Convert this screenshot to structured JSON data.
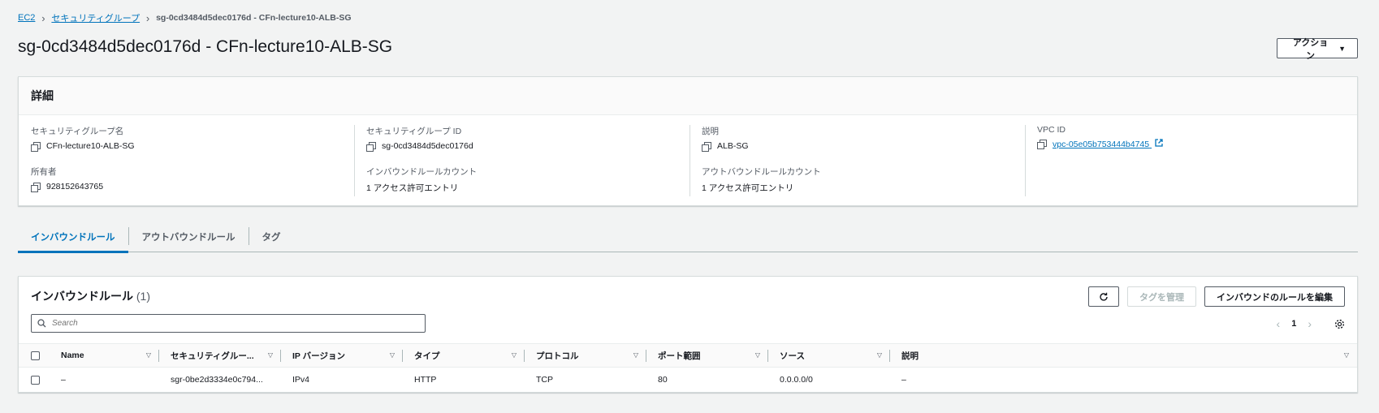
{
  "breadcrumb": {
    "items": [
      "EC2",
      "セキュリティグループ"
    ],
    "current": "sg-0cd3484d5dec0176d - CFn-lecture10-ALB-SG"
  },
  "page": {
    "title": "sg-0cd3484d5dec0176d - CFn-lecture10-ALB-SG",
    "actions_label": "アクション"
  },
  "details": {
    "heading": "詳細",
    "sg_name_label": "セキュリティグループ名",
    "sg_name": "CFn-lecture10-ALB-SG",
    "sg_id_label": "セキュリティグループ ID",
    "sg_id": "sg-0cd3484d5dec0176d",
    "description_label": "説明",
    "description": "ALB-SG",
    "vpc_label": "VPC ID",
    "vpc_id": "vpc-05e05b753444b4745",
    "owner_label": "所有者",
    "owner": "928152643765",
    "inbound_count_label": "インバウンドルールカウント",
    "inbound_count": "1 アクセス許可エントリ",
    "outbound_count_label": "アウトバウンドルールカウント",
    "outbound_count": "1 アクセス許可エントリ"
  },
  "tabs": [
    "インバウンドルール",
    "アウトバウンドルール",
    "タグ"
  ],
  "rules": {
    "title": "インバウンドルール",
    "count": "(1)",
    "manage_tags_label": "タグを管理",
    "edit_label": "インバウンドのルールを編集",
    "search_placeholder": "Search",
    "page_number": "1",
    "columns": [
      "Name",
      "セキュリティグルー...",
      "IP バージョン",
      "タイプ",
      "プロトコル",
      "ポート範囲",
      "ソース",
      "説明"
    ],
    "rows": [
      [
        "–",
        "sgr-0be2d3334e0c794...",
        "IPv4",
        "HTTP",
        "TCP",
        "80",
        "0.0.0.0/0",
        "–"
      ]
    ]
  },
  "colors": {
    "accent": "#0073bb",
    "background": "#f2f3f3"
  }
}
